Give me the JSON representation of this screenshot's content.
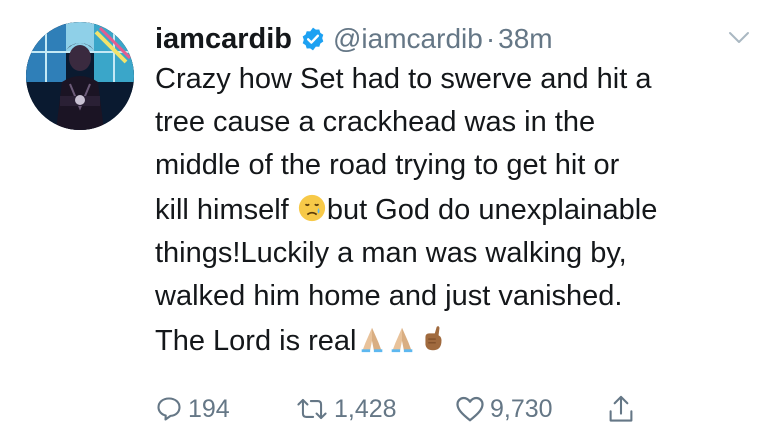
{
  "tweet": {
    "display_name": "iamcardib",
    "handle": "@iamcardib",
    "separator": "·",
    "time": "38m",
    "verified_icon": "verified-badge-icon",
    "text_lines": [
      "Crazy how Set had to swerve and hit a",
      "tree cause a crackhead was in the",
      "middle of the road trying to get hit or",
      "kill himself",
      "but God do unexplainable",
      "things!Luckily a man was walking by,",
      "walked him home and just vanished.",
      "The Lord is real"
    ],
    "emojis": [
      "sad-relieved-face-emoji",
      "folded-hands-emoji",
      "folded-hands-emoji",
      "hand-gesture-emoji"
    ]
  },
  "actions": {
    "reply_count": "194",
    "retweet_count": "1,428",
    "like_count": "9,730"
  },
  "colors": {
    "text": "#14171a",
    "secondary": "#657786",
    "verified": "#1da1f2"
  }
}
